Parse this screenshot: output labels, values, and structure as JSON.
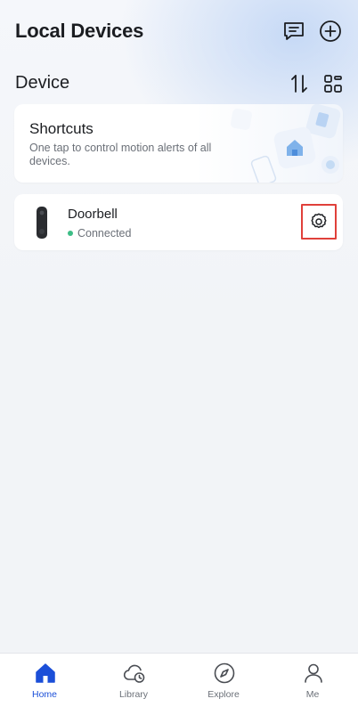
{
  "header": {
    "title": "Local Devices",
    "icons": [
      "message-icon",
      "add-icon"
    ]
  },
  "section": {
    "title": "Device",
    "icons": [
      "sort-icon",
      "grid-view-icon"
    ]
  },
  "shortcuts": {
    "title": "Shortcuts",
    "description": "One tap to control motion alerts of all devices."
  },
  "device": {
    "name": "Doorbell",
    "status": "Connected",
    "status_color": "#3dbd86"
  },
  "tabs": [
    {
      "label": "Home",
      "icon": "home-icon",
      "active": true
    },
    {
      "label": "Library",
      "icon": "cloud-clock-icon",
      "active": false
    },
    {
      "label": "Explore",
      "icon": "compass-icon",
      "active": false
    },
    {
      "label": "Me",
      "icon": "person-icon",
      "active": false
    }
  ],
  "colors": {
    "accent": "#1b4fd8",
    "highlight_box": "#e0403a",
    "background": "#f2f4f7"
  }
}
